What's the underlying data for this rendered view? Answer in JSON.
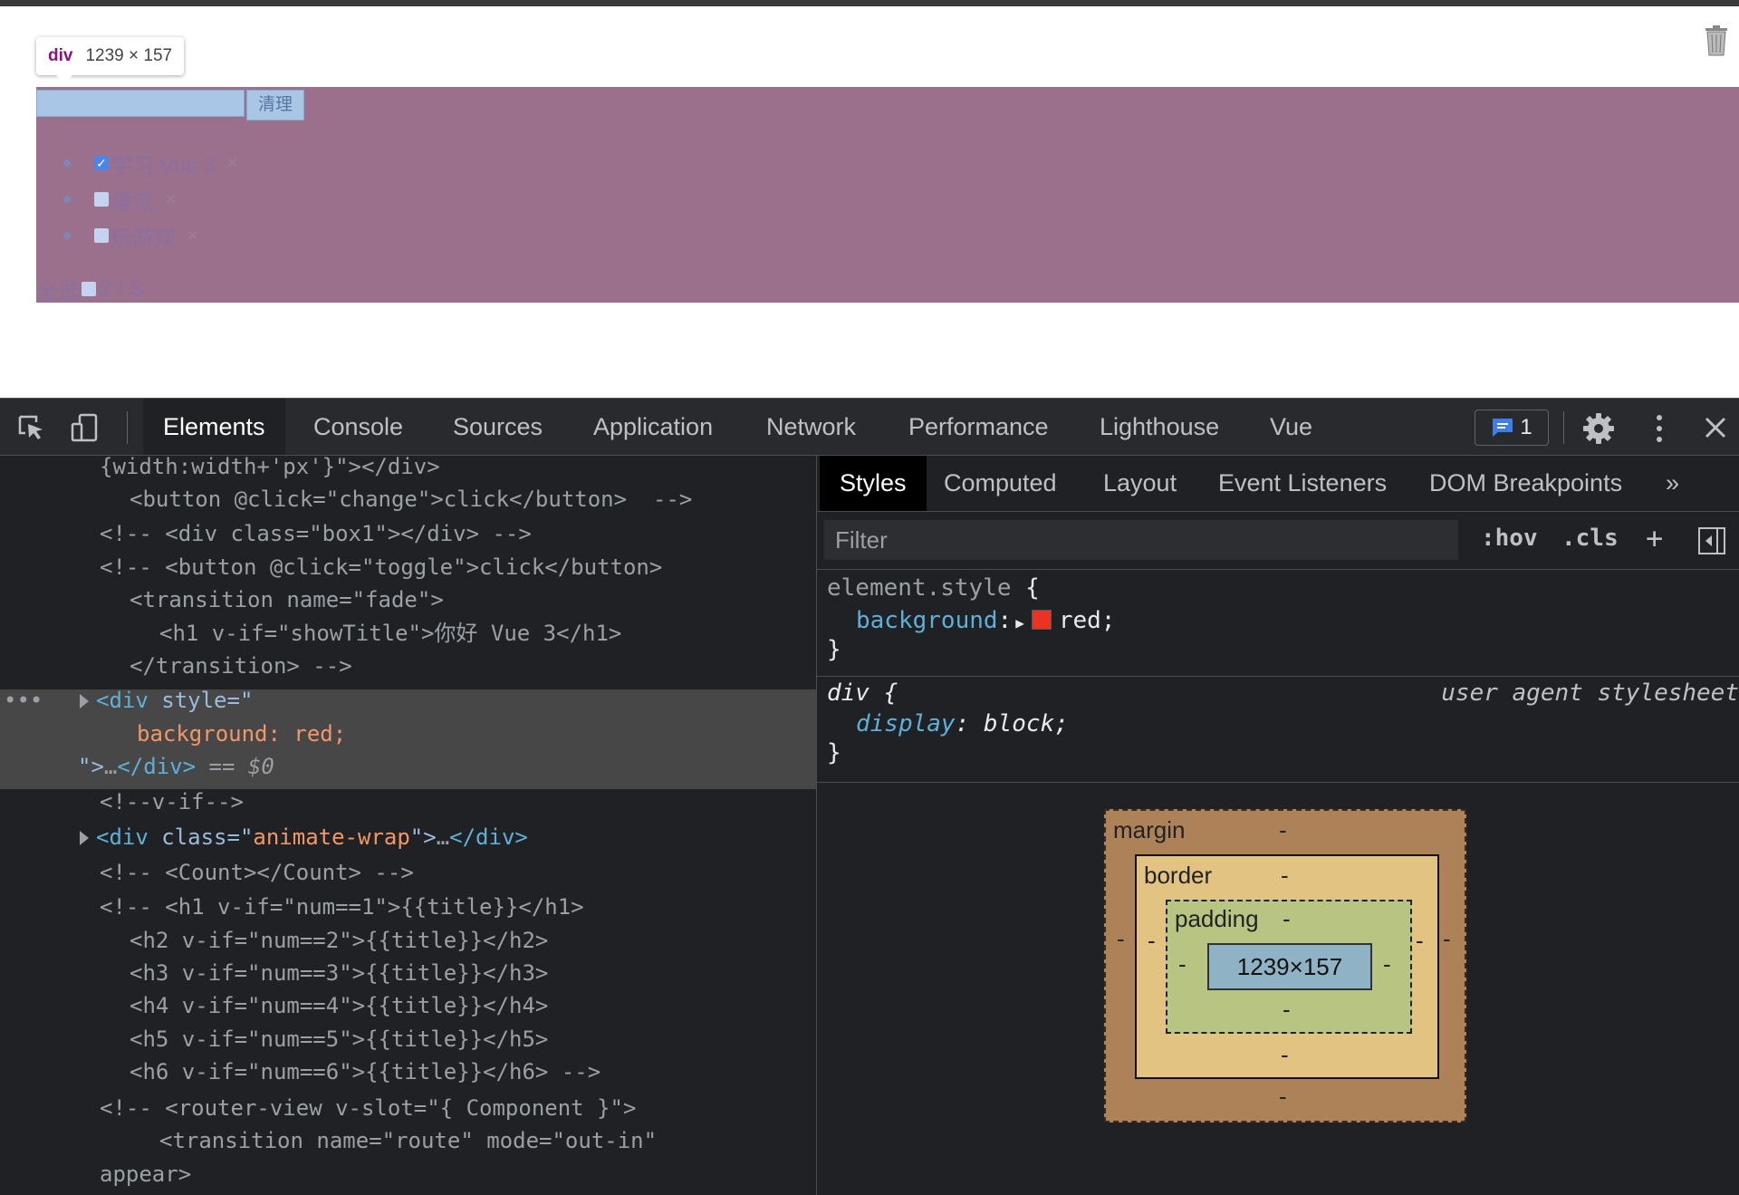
{
  "page": {
    "tooltip": {
      "tag": "div",
      "dims": "1239 × 157"
    },
    "todo_button": "清理",
    "todos": [
      {
        "label": "学习 Vue 3",
        "checked": true,
        "delete": "×"
      },
      {
        "label": "睡觉",
        "checked": false,
        "delete": "×"
      },
      {
        "label": "玩游戏",
        "checked": false,
        "delete": "×"
      }
    ],
    "footer": {
      "select_all": "全选",
      "progress": "2 / 3"
    },
    "highlight_color": "#9b708c",
    "icons": [
      "trash-icon"
    ]
  },
  "devtools": {
    "tabs": [
      "Elements",
      "Console",
      "Sources",
      "Application",
      "Network",
      "Performance",
      "Lighthouse",
      "Vue"
    ],
    "active_tab": "Elements",
    "issues_count": "1",
    "elements": {
      "lines": {
        "l0": "{width:width+'px'}\"></div>",
        "l1": "<button @click=\"change\">click</button>  -->",
        "l2": "<!-- <div class=\"box1\"></div> -->",
        "l3": "<!-- <button @click=\"toggle\">click</button>",
        "l4": "<transition name=\"fade\">",
        "l5": "<h1 v-if=\"showTitle\">你好 Vue 3</h1>",
        "l6": "</transition> -->",
        "l10": "<!--v-if-->",
        "l12": "<!-- <Count></Count> -->",
        "l13": "<!-- <h1 v-if=\"num==1\">{{title}}</h1>",
        "l14": "<h2 v-if=\"num==2\">{{title}}</h2>",
        "l15": "<h3 v-if=\"num==3\">{{title}}</h3>",
        "l16": "<h4 v-if=\"num==4\">{{title}}</h4>",
        "l17": "<h5 v-if=\"num==5\">{{title}}</h5>",
        "l18": "<h6 v-if=\"num==6\">{{title}}</h6> -->",
        "l19": "<!-- <router-view v-slot=\"{ Component }\">",
        "l20": "<transition name=\"route\" mode=\"out-in\"",
        "l21": "appear>"
      },
      "selected": {
        "dots": "•••",
        "open_tag": "<div",
        "attr": "style",
        "eq_quote": "=\"",
        "style_value": "background: red;",
        "close_quote": "\">",
        "ellipsis": "…",
        "end_tag": "</div>",
        "marker": "== $0"
      },
      "animate_line": {
        "open_tag": "<div",
        "attr": "class",
        "eq_quote": "=\"",
        "value": "animate-wrap",
        "close_quote": "\">",
        "ellipsis": "…",
        "end_tag": "</div>"
      }
    },
    "side_tabs": [
      "Styles",
      "Computed",
      "Layout",
      "Event Listeners",
      "DOM Breakpoints",
      "»"
    ],
    "active_side_tab": "Styles",
    "filter_placeholder": "Filter",
    "filter_buttons": [
      ":hov",
      ".cls",
      "+"
    ],
    "styles": {
      "element_selector": "element.style",
      "open_brace": "{",
      "close_brace": "}",
      "bg_prop": "background",
      "bg_value": "red;",
      "bg_swatch_color": "#ea3323",
      "div_selector": "div",
      "ua_label": "user agent stylesheet",
      "display_prop": "display",
      "display_value": "block;"
    },
    "box_model": {
      "margin_label": "margin",
      "border_label": "border",
      "padding_label": "padding",
      "content": "1239×157",
      "dash": "-"
    }
  }
}
